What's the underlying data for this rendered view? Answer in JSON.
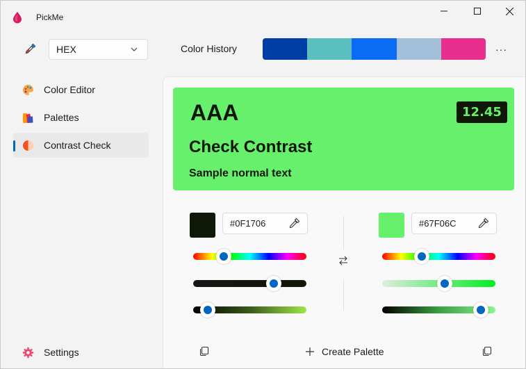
{
  "app": {
    "title": "PickMe"
  },
  "toolbar": {
    "format": "HEX",
    "history_label": "Color History",
    "history_colors": [
      "#003da5",
      "#5bbfbf",
      "#0a6cf5",
      "#a3bfd9",
      "#e82f8e"
    ],
    "more": "···"
  },
  "nav": {
    "items": [
      {
        "label": "Color Editor",
        "icon": "palette-icon"
      },
      {
        "label": "Palettes",
        "icon": "palettes-icon"
      },
      {
        "label": "Contrast Check",
        "icon": "contrast-icon",
        "active": true
      }
    ],
    "settings": "Settings"
  },
  "preview": {
    "rating": "AAA",
    "ratio": "12.45",
    "large_text": "Check Contrast",
    "normal_text": "Sample normal text",
    "foreground": "#0F1706",
    "background": "#67F06C"
  },
  "foreground": {
    "hex": "#0F1706",
    "color": "#0F1706",
    "hue_level": 0.27,
    "saturation_level": 0.71,
    "lightness_level": 0.13
  },
  "background": {
    "hex": "#67F06C",
    "color": "#67F06C",
    "hue_level": 0.35,
    "saturation_level": 0.55,
    "lightness_level": 0.87
  },
  "footer": {
    "create_palette": "Create Palette"
  },
  "colors": {
    "accent": "#0067c0",
    "window_bg": "#f3f3f3"
  }
}
